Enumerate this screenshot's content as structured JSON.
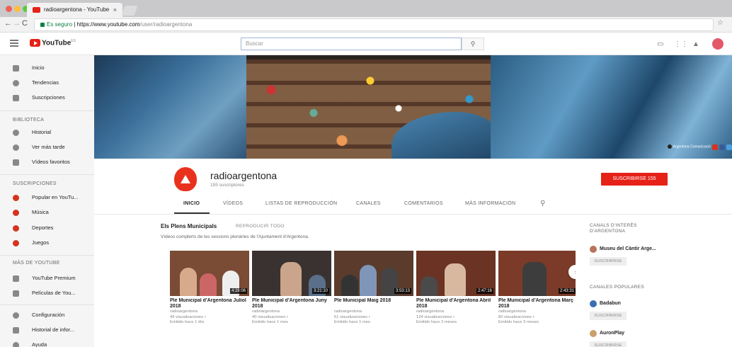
{
  "browser": {
    "tab_title": "radioargentona - YouTube",
    "url_secure": "Es seguro",
    "url_host": "https://www.youtube.com",
    "url_path": "/user/radioargentona"
  },
  "masthead": {
    "logo_text": "YouTube",
    "logo_sup": "ES",
    "search_placeholder": "Buscar"
  },
  "sidebar": {
    "main": [
      {
        "label": "Inicio",
        "icon": "home-icon"
      },
      {
        "label": "Tendencias",
        "icon": "trending-icon"
      },
      {
        "label": "Suscripciones",
        "icon": "subscriptions-icon"
      }
    ],
    "library_header": "BIBLIOTECA",
    "library": [
      {
        "label": "Historial",
        "icon": "history-icon"
      },
      {
        "label": "Ver más tarde",
        "icon": "watch-later-icon"
      },
      {
        "label": "Vídeos favoritos",
        "icon": "playlist-icon"
      }
    ],
    "subs_header": "SUSCRIPCIONES",
    "subs": [
      {
        "label": "Popular en YouTu...",
        "icon": "channel-icon"
      },
      {
        "label": "Música",
        "icon": "channel-icon"
      },
      {
        "label": "Deportes",
        "icon": "channel-icon"
      },
      {
        "label": "Juegos",
        "icon": "channel-icon"
      }
    ],
    "more_header": "MÁS DE YOUTUBE",
    "more": [
      {
        "label": "YouTube Premium",
        "icon": "premium-icon"
      },
      {
        "label": "Películas de You...",
        "icon": "movies-icon"
      }
    ],
    "settings": [
      {
        "label": "Configuración",
        "icon": "gear-icon"
      },
      {
        "label": "Historial de infor...",
        "icon": "flag-icon"
      },
      {
        "label": "Ayuda",
        "icon": "help-icon"
      }
    ]
  },
  "banner": {
    "tag": "Argentona Comunicació"
  },
  "channel": {
    "name": "radioargentona",
    "subscribers": "155 suscriptores",
    "subscribe_label": "SUSCRIBIRSE",
    "subscribe_count": "155",
    "tabs": [
      "INICIO",
      "VÍDEOS",
      "LISTAS DE REPRODUCCIÓN",
      "CANALES",
      "COMENTARIOS",
      "MÁS INFORMACIÓN"
    ]
  },
  "section": {
    "title": "Els Plens Municipals",
    "play_all": "REPRODUCIR TODO",
    "description": "Vídeos complerts de les sessions plenàries de l'Ajuntament d'Argentona."
  },
  "videos": [
    {
      "title": "Ple Municipal d'Argentona Juliol 2018",
      "channel": "radioargentona",
      "views": "49 visualizaciones •",
      "age": "Emitido hace 1 día",
      "duration": "4:28:06"
    },
    {
      "title": "Ple Municipal d'Argentona Juny 2018",
      "channel": "radioargentona",
      "views": "40 visualizaciones •",
      "age": "Emitido hace 1 mes",
      "duration": "3:21:10"
    },
    {
      "title": "Ple Municipal Maig 2018",
      "channel": "radioargentona",
      "views": "61 visualizaciones •",
      "age": "Emitido hace 1 mes",
      "duration": "3:53:13"
    },
    {
      "title": "Ple Municipal d'Argentona Abril 2018",
      "channel": "radioargentona",
      "views": "124 visualizaciones •",
      "age": "Emitido hace 2 meses",
      "duration": "2:47:16"
    },
    {
      "title": "Ple Municipal d'Argentona Març 2018",
      "channel": "radioargentona",
      "views": "80 visualizaciones •",
      "age": "Emitido hace 3 meses",
      "duration": "2:43:31"
    }
  ],
  "related": {
    "interest_header": "CANALS D'INTERÈS D'ARGENTONA",
    "interest": [
      {
        "name": "Museu del Càntir Arge...",
        "button": "SUSCRIBIRSE"
      }
    ],
    "popular_header": "CANALES POPULARES",
    "popular": [
      {
        "name": "Badabun",
        "button": "SUSCRIBIRSE"
      },
      {
        "name": "AuronPlay",
        "button": "SUSCRIBIRSE"
      }
    ]
  }
}
